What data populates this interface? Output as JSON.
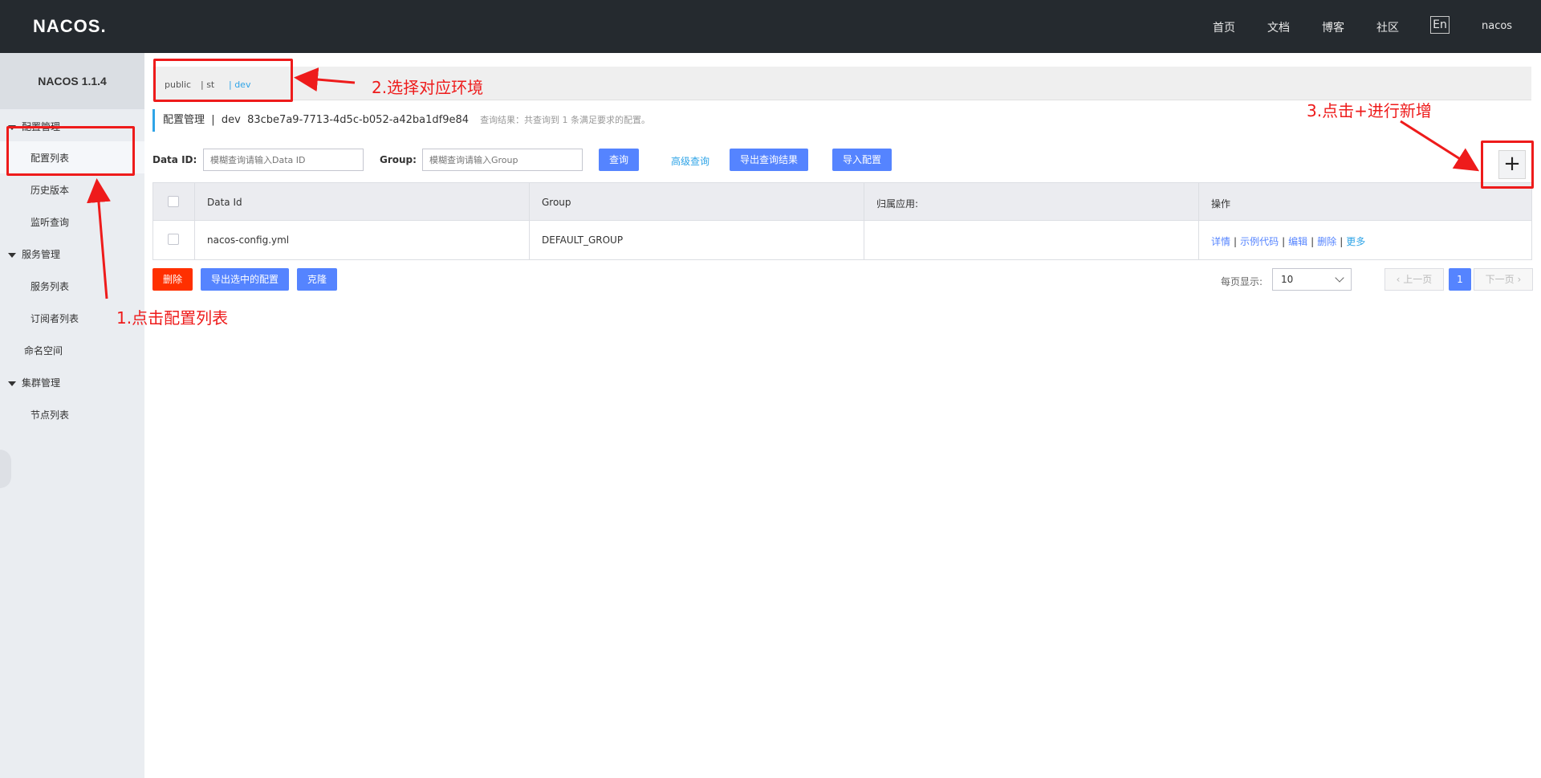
{
  "header": {
    "logo": "NACOS.",
    "nav": [
      "首页",
      "文档",
      "博客",
      "社区"
    ],
    "lang": "En",
    "user": "nacos"
  },
  "sidebar": {
    "title": "NACOS 1.1.4",
    "groups": {
      "config": "配置管理",
      "service": "服务管理",
      "namespace": "命名空间",
      "cluster": "集群管理"
    },
    "items": {
      "config_list": "配置列表",
      "history": "历史版本",
      "listen": "监听查询",
      "service_list": "服务列表",
      "subscriber_list": "订阅者列表",
      "node_list": "节点列表"
    }
  },
  "namespaces": {
    "public": "public",
    "st": "| st",
    "dev": "| dev"
  },
  "title": {
    "main": "配置管理  |  dev  83cbe7a9-7713-4d5c-b052-a42ba1df9e84",
    "hint": "查询结果：共查询到 1 条满足要求的配置。"
  },
  "search": {
    "dataid_label": "Data ID:",
    "dataid_placeholder": "模糊查询请输入Data ID",
    "group_label": "Group:",
    "group_placeholder": "模糊查询请输入Group",
    "query": "查询",
    "advanced": "高级查询",
    "export": "导出查询结果",
    "import": "导入配置",
    "add": "+"
  },
  "table": {
    "columns": [
      "Data Id",
      "Group",
      "归属应用:",
      "操作"
    ],
    "rows": [
      {
        "data_id": "nacos-config.yml",
        "group": "DEFAULT_GROUP",
        "app": ""
      }
    ],
    "ops": {
      "detail": "详情",
      "sample": "示例代码",
      "edit": "编辑",
      "delete": "删除",
      "more": "更多"
    }
  },
  "footer": {
    "delete": "删除",
    "export_selected": "导出选中的配置",
    "clone": "克隆",
    "pagesize_label": "每页显示:",
    "pagesize": "10",
    "prev": "上一页",
    "page": "1",
    "next": "下一页"
  },
  "annotations": {
    "step1": "1.点击配置列表",
    "step2": "2.选择对应环境",
    "step3": "3.点击+进行新增",
    "color": "#ee1b1b"
  }
}
